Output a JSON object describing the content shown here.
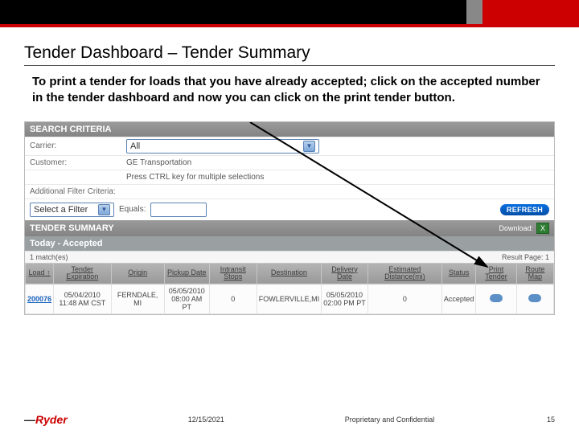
{
  "slide": {
    "title": "Tender Dashboard – Tender Summary",
    "instruction": "To print a tender for loads that you have already accepted; click on the accepted number in the tender dashboard and now you can click on the print tender button."
  },
  "search": {
    "header": "SEARCH CRITERIA",
    "carrier_label": "Carrier:",
    "carrier_value": "All",
    "customer_label": "Customer:",
    "customer_value": "GE Transportation",
    "hint": "Press CTRL key for multiple selections",
    "addl_label": "Additional Filter Criteria:",
    "filter_select": "Select a Filter",
    "equals_label": "Equals:",
    "refresh": "REFRESH"
  },
  "summary": {
    "header": "TENDER SUMMARY",
    "download_label": "Download:",
    "subheader": "Today - Accepted",
    "matches": "1 match(es)",
    "result_page": "Result Page: 1"
  },
  "columns": {
    "load": "Load ↑",
    "expiration": "Tender Expiration",
    "origin": "Origin",
    "pickup": "Pickup Date",
    "intransit": "Intransit Stops",
    "destination": "Destination",
    "delivery": "Delivery Date",
    "distance": "Estimated Distance(mi)",
    "status": "Status",
    "print": "Print Tender",
    "route": "Route Map"
  },
  "row": {
    "load": "200076",
    "expiration_line1": "05/04/2010",
    "expiration_line2": "11:48 AM CST",
    "origin": "FERNDALE, MI",
    "pickup_line1": "05/05/2010",
    "pickup_line2": "08:00 AM PT",
    "intransit": "0",
    "destination": "FOWLERVILLE,MI",
    "delivery_line1": "05/05/2010",
    "delivery_line2": "02:00 PM PT",
    "distance": "0",
    "status": "Accepted"
  },
  "footer": {
    "logo_text": "Ryder",
    "date": "12/15/2021",
    "confidential": "Proprietary and Confidential",
    "page": "15"
  }
}
